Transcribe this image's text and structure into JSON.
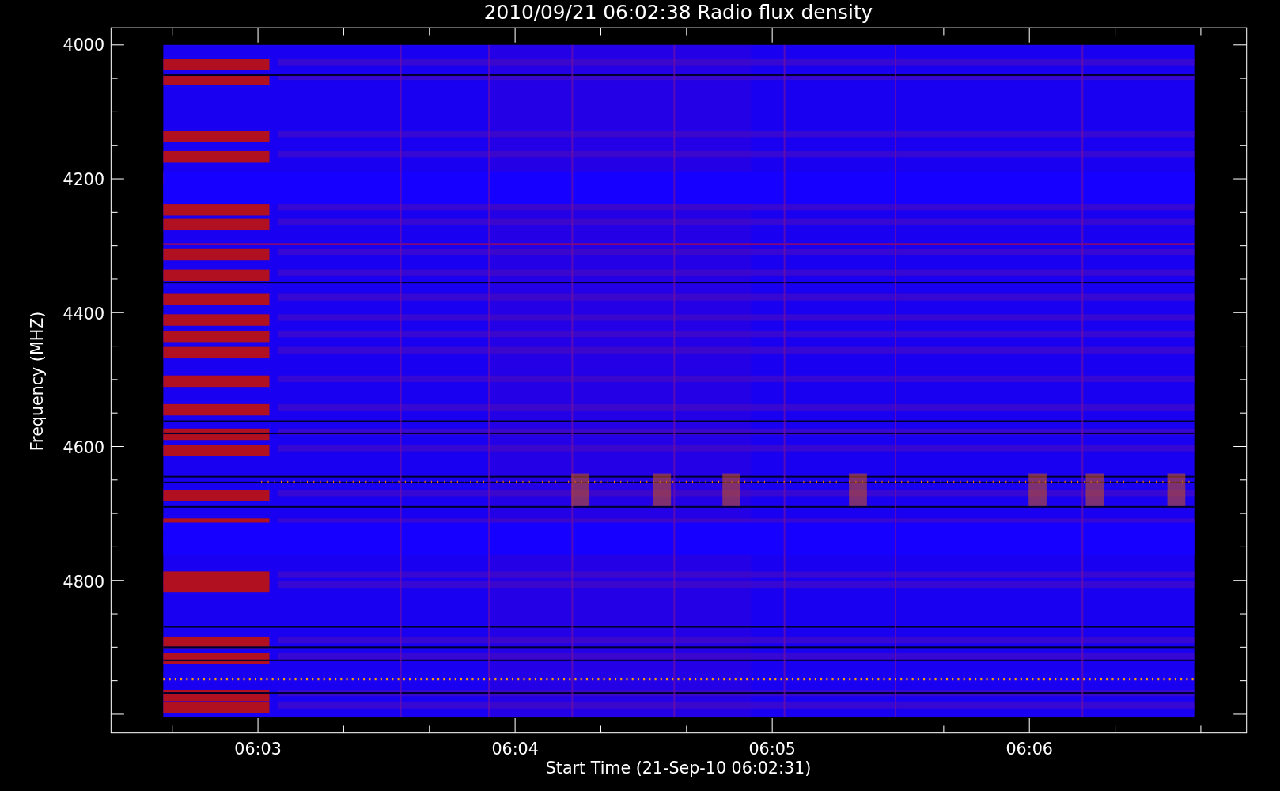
{
  "title": "2010/09/21 06:02:38 Radio flux density",
  "y_axis": {
    "label": "Frequency (MHZ)",
    "ticks": [
      "4000",
      "4200",
      "4400",
      "4600",
      "4800"
    ]
  },
  "x_axis": {
    "label": "Start Time (21-Sep-10 06:02:31)",
    "ticks": [
      "06:03",
      "06:04",
      "06:05",
      "06:06"
    ]
  }
}
